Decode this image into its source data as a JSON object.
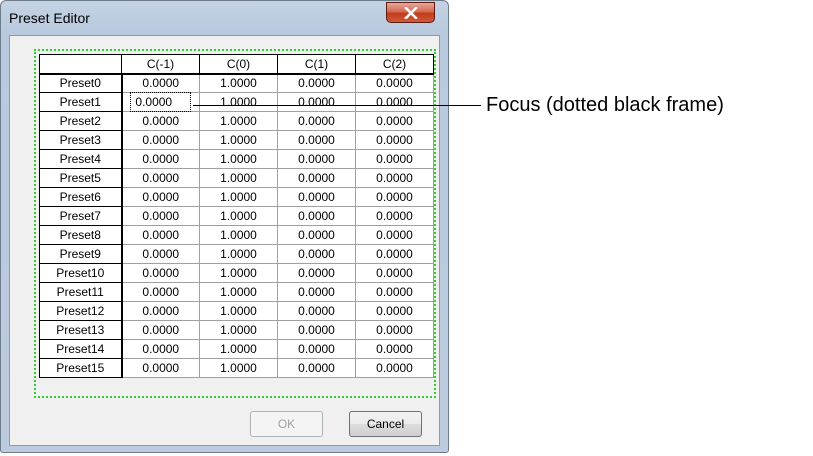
{
  "window": {
    "title": "Preset Editor",
    "close_icon": "close-x-icon"
  },
  "grid": {
    "columns": [
      "",
      "C(-1)",
      "C(0)",
      "C(1)",
      "C(2)"
    ],
    "rows": [
      {
        "label": "Preset0",
        "values": [
          "0.0000",
          "1.0000",
          "0.0000",
          "0.0000"
        ]
      },
      {
        "label": "Preset1",
        "values": [
          "0.0000",
          "1.0000",
          "0.0000",
          "0.0000"
        ]
      },
      {
        "label": "Preset2",
        "values": [
          "0.0000",
          "1.0000",
          "0.0000",
          "0.0000"
        ]
      },
      {
        "label": "Preset3",
        "values": [
          "0.0000",
          "1.0000",
          "0.0000",
          "0.0000"
        ]
      },
      {
        "label": "Preset4",
        "values": [
          "0.0000",
          "1.0000",
          "0.0000",
          "0.0000"
        ]
      },
      {
        "label": "Preset5",
        "values": [
          "0.0000",
          "1.0000",
          "0.0000",
          "0.0000"
        ]
      },
      {
        "label": "Preset6",
        "values": [
          "0.0000",
          "1.0000",
          "0.0000",
          "0.0000"
        ]
      },
      {
        "label": "Preset7",
        "values": [
          "0.0000",
          "1.0000",
          "0.0000",
          "0.0000"
        ]
      },
      {
        "label": "Preset8",
        "values": [
          "0.0000",
          "1.0000",
          "0.0000",
          "0.0000"
        ]
      },
      {
        "label": "Preset9",
        "values": [
          "0.0000",
          "1.0000",
          "0.0000",
          "0.0000"
        ]
      },
      {
        "label": "Preset10",
        "values": [
          "0.0000",
          "1.0000",
          "0.0000",
          "0.0000"
        ]
      },
      {
        "label": "Preset11",
        "values": [
          "0.0000",
          "1.0000",
          "0.0000",
          "0.0000"
        ]
      },
      {
        "label": "Preset12",
        "values": [
          "0.0000",
          "1.0000",
          "0.0000",
          "0.0000"
        ]
      },
      {
        "label": "Preset13",
        "values": [
          "0.0000",
          "1.0000",
          "0.0000",
          "0.0000"
        ]
      },
      {
        "label": "Preset14",
        "values": [
          "0.0000",
          "1.0000",
          "0.0000",
          "0.0000"
        ]
      },
      {
        "label": "Preset15",
        "values": [
          "0.0000",
          "1.0000",
          "0.0000",
          "0.0000"
        ]
      }
    ],
    "focused_cell": {
      "row": 1,
      "col": 0
    },
    "focus_border_color": "#33cc33"
  },
  "buttons": {
    "ok": "OK",
    "cancel": "Cancel"
  },
  "annotation": {
    "text": "Focus (dotted black frame)"
  }
}
